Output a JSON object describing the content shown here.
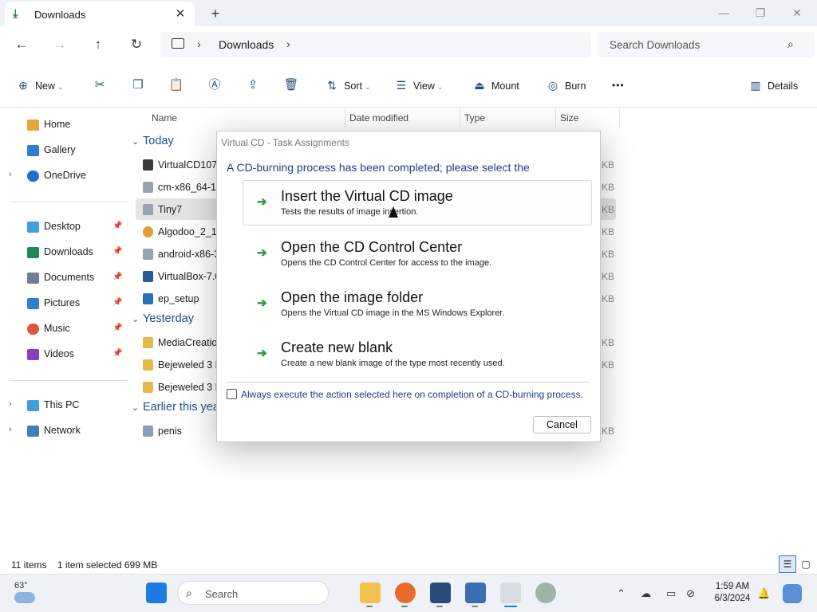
{
  "window": {
    "tab_title": "Downloads",
    "new_tab": "+",
    "close_tab": "✕",
    "minimize": "—",
    "maximize": "❐",
    "close": "✕"
  },
  "nav": {
    "back": "←",
    "forward": "→",
    "up": "↑",
    "refresh": "↻",
    "breadcrumb_sep": "›",
    "breadcrumb": "Downloads",
    "search_placeholder": "Search Downloads"
  },
  "commands": {
    "new": "New",
    "sort": "Sort",
    "view": "View",
    "mount": "Mount",
    "burn": "Burn",
    "more": "•••",
    "details": "Details"
  },
  "sidebar": {
    "items": [
      {
        "label": "Home",
        "color": "#e8a33a"
      },
      {
        "label": "Gallery",
        "color": "#2f7fd0"
      },
      {
        "label": "OneDrive",
        "color": "#1f6fd1"
      },
      {
        "label": "Desktop",
        "color": "#3f9fe0"
      },
      {
        "label": "Downloads",
        "color": "#1f8a55"
      },
      {
        "label": "Documents",
        "color": "#6f7f94"
      },
      {
        "label": "Pictures",
        "color": "#2f7fd0"
      },
      {
        "label": "Music",
        "color": "#e0543a"
      },
      {
        "label": "Videos",
        "color": "#8a3fc0"
      },
      {
        "label": "This PC",
        "color": "#3f9fe0"
      },
      {
        "label": "Network",
        "color": "#3f7fc0"
      }
    ],
    "pin": "📌",
    "expand": "›"
  },
  "columns": {
    "name": "Name",
    "date_modified": "Date modified",
    "type": "Type",
    "size": "Size"
  },
  "groups": {
    "today": "Today",
    "yesterday": "Yesterday",
    "earlier": "Earlier this yea"
  },
  "files": [
    {
      "name": "VirtualCD1070",
      "color": "#3a3a3a"
    },
    {
      "name": "cm-x86_64-14",
      "color": "#9aa3ad"
    },
    {
      "name": "Tiny7",
      "color": "#9aa3ad"
    },
    {
      "name": "Algodoo_2_1_",
      "color": "#e0a030"
    },
    {
      "name": "android-x86-3",
      "color": "#9aa3ad"
    },
    {
      "name": "VirtualBox-7.0",
      "color": "#2a5a9a"
    },
    {
      "name": "ep_setup",
      "color": "#2a6fc0"
    },
    {
      "name": "MediaCreation",
      "color": "#e8b84a"
    },
    {
      "name": "Bejeweled 3 PI",
      "color": "#e8b84a"
    },
    {
      "name": "Bejeweled 3 PI",
      "color": "#e8b84a"
    },
    {
      "name": "penis",
      "color": "#8aa0b8"
    }
  ],
  "size_unit": "KB",
  "status": {
    "items": "11 items",
    "selected": "1 item selected  699 MB"
  },
  "dialog": {
    "title": "Virtual CD - Task Assignments",
    "message": "A CD-burning process has been completed; please select the",
    "actions": [
      {
        "title": "Insert the Virtual CD image",
        "desc": "Tests the results of image insertion."
      },
      {
        "title": "Open the CD Control Center",
        "desc": "Opens the CD Control Center for access to the image."
      },
      {
        "title": "Open the image folder",
        "desc": "Opens the Virtual CD image in the MS Windows Explorer."
      },
      {
        "title": "Create new blank",
        "desc": "Create a new blank image of the type most recently used."
      }
    ],
    "arrow": "➔",
    "checkbox_label": "Always execute the action selected here on completion of a CD-burning process.",
    "cancel": "Cancel"
  },
  "taskbar": {
    "temperature": "63°",
    "search_label": "Search",
    "time": "1:59 AM",
    "date": "6/3/2024"
  }
}
